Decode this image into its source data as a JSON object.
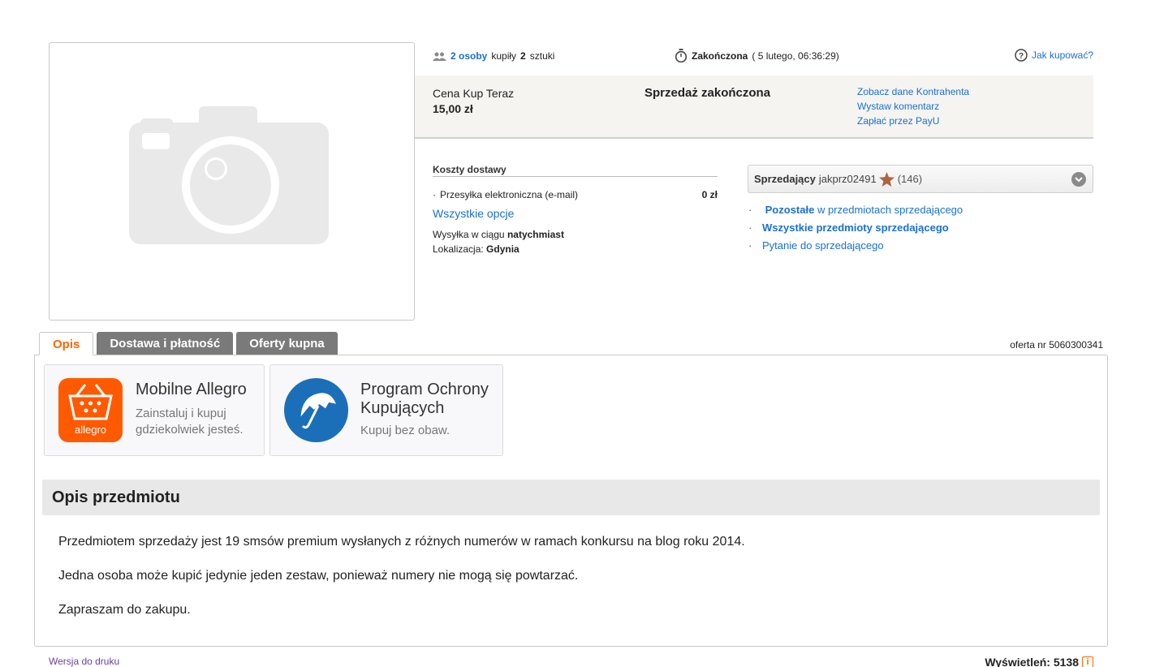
{
  "summary": {
    "buyers_link": "2 osoby",
    "bought_text": "kupiły",
    "items_count": "2",
    "items_text": "sztuki",
    "ended_label": "Zakończona",
    "ended_date": "( 5 lutego, 06:36:29)",
    "how_to_buy": "Jak kupować?"
  },
  "price": {
    "label": "Cena Kup Teraz",
    "value": "15,00 zł",
    "status": "Sprzedaż zakończona",
    "links": [
      "Zobacz dane Kontrahenta",
      "Wystaw komentarz",
      "Zapłać przez PayU"
    ]
  },
  "delivery": {
    "title": "Koszty dostawy",
    "method": "Przesyłka elektroniczna (e-mail)",
    "method_price": "0 zł",
    "all_options": "Wszystkie opcje",
    "ship_label": "Wysyłka w ciągu",
    "ship_value": "natychmiast",
    "location_label": "Lokalizacja:",
    "location_value": "Gdynia"
  },
  "seller": {
    "label": "Sprzedający",
    "nick": "jakprz02491",
    "rating_count": "(146)",
    "other_bold": "Pozostałe",
    "other_rest": "w przedmiotach sprzedającego",
    "all_items": "Wszystkie przedmioty sprzedającego",
    "question": "Pytanie do sprzedającego"
  },
  "tabs": [
    {
      "label": "Opis"
    },
    {
      "label": "Dostawa i płatność"
    },
    {
      "label": "Oferty kupna"
    }
  ],
  "offer_number": "oferta nr 5060300341",
  "promos": {
    "mobile_title": "Mobilne Allegro",
    "mobile_sub1": "Zainstaluj i kupuj",
    "mobile_sub2": "gdziekolwiek jesteś.",
    "allegro_logo": "allegro",
    "protect_title1": "Program Ochrony",
    "protect_title2": "Kupujących",
    "protect_sub": "Kupuj bez obaw."
  },
  "description": {
    "title": "Opis przedmiotu",
    "paragraphs": [
      "Przedmiotem sprzedaży jest 19 smsów premium wysłanych z różnych numerów w ramach konkursu na blog roku 2014.",
      "Jedna osoba może kupić jedynie jeden zestaw, ponieważ numery nie mogą się powtarzać.",
      "Zapraszam do zakupu."
    ]
  },
  "footer": {
    "print": "Wersja do druku",
    "views": "Wyświetleń: 5138",
    "info_icon": "i"
  },
  "colors": {
    "link": "#1a6fd6",
    "accent": "#ff6600",
    "tab_inactive": "#7a7a7a"
  }
}
